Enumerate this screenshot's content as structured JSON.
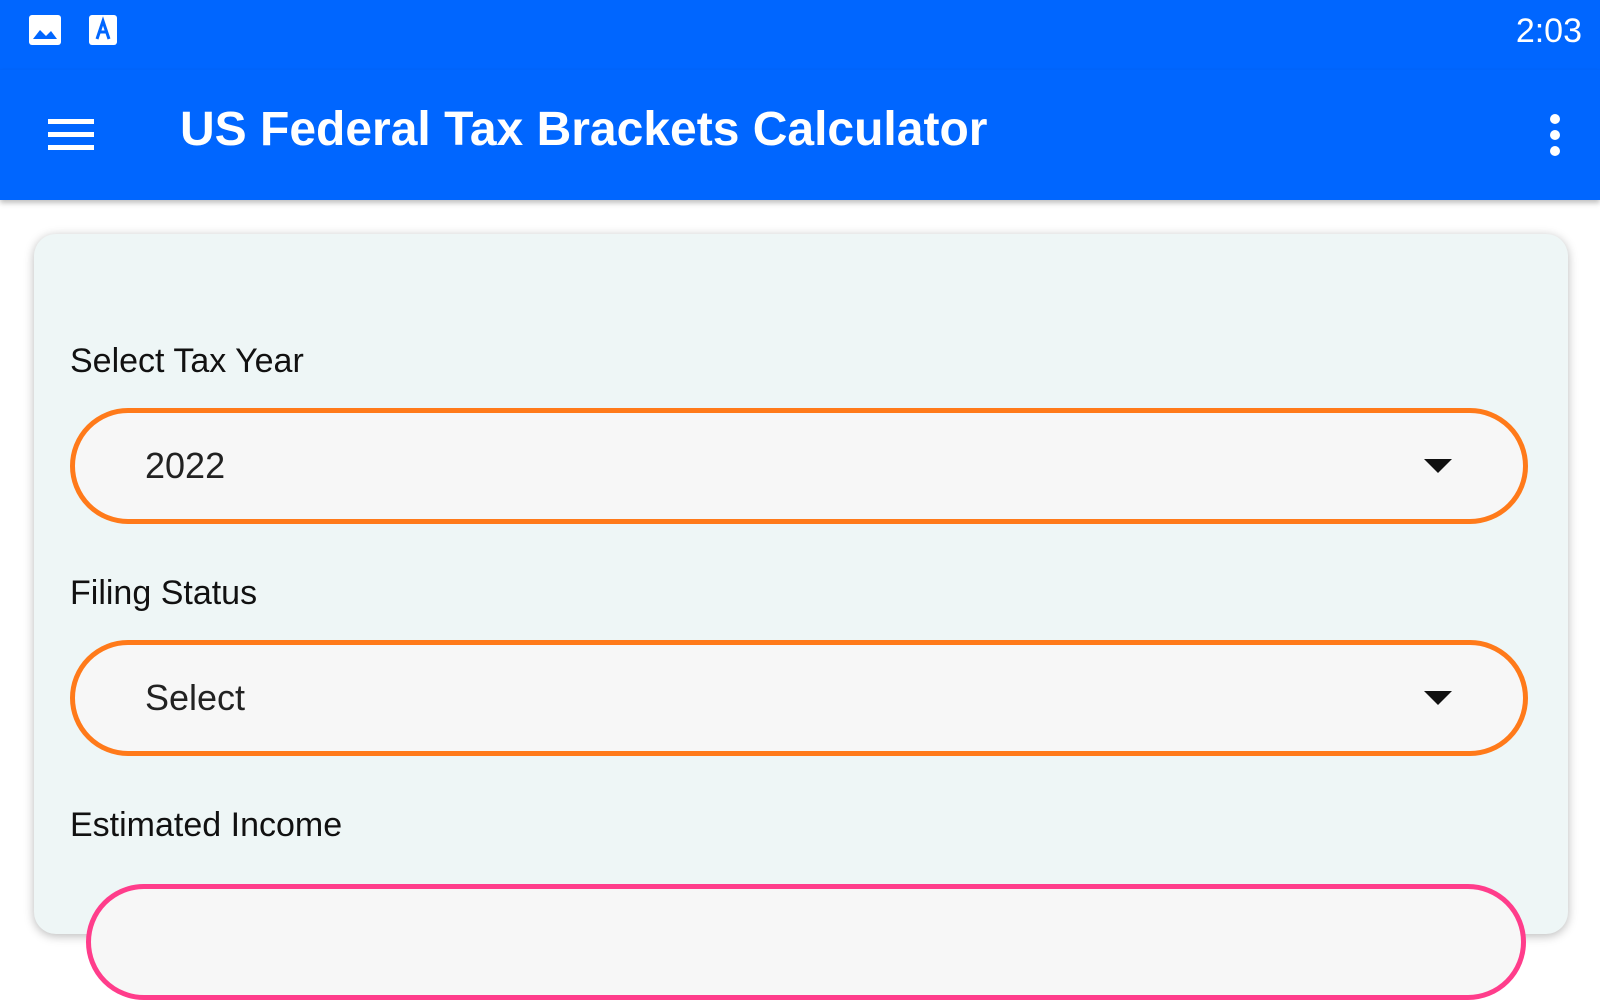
{
  "status_bar": {
    "time": "2:03",
    "icons": [
      "image-notification-icon",
      "text-notification-icon"
    ]
  },
  "app_bar": {
    "title": "US Federal Tax Brackets Calculator",
    "icons": [
      "hamburger-menu-icon",
      "more-vert-icon"
    ],
    "color": "#0066ff"
  },
  "form": {
    "tax_year": {
      "label": "Select Tax Year",
      "value": "2022"
    },
    "filing_status": {
      "label": "Filing Status",
      "value": "Select"
    },
    "estimated_income": {
      "label": "Estimated Income",
      "value": ""
    }
  },
  "colors": {
    "accent": "#0066ff",
    "dropdown_border": "#ff7a1a",
    "income_border": "#ff3d8b",
    "card_bg": "#eef6f6"
  }
}
